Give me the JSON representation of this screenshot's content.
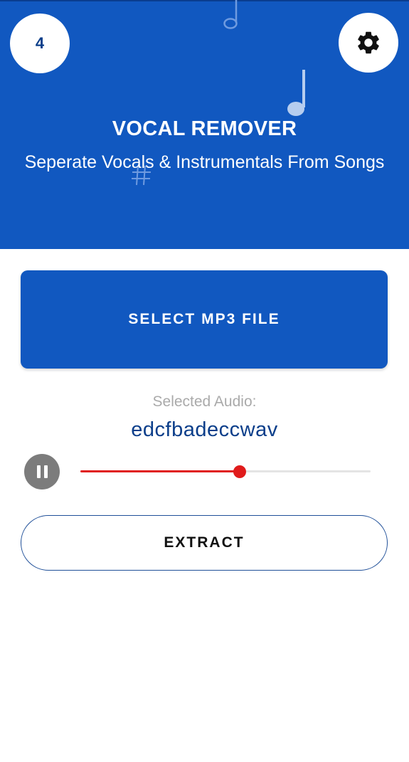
{
  "header": {
    "badge_count": "4",
    "title": "VOCAL REMOVER",
    "subtitle": "Seperate Vocals & Instrumentals From Songs",
    "settings_icon": "gear-icon",
    "decorations": [
      "music-note-icon",
      "music-note-icon",
      "sharp-icon"
    ]
  },
  "main": {
    "select_button_label": "SELECT MP3 FILE",
    "selected_label": "Selected Audio:",
    "selected_name": "edcfbadeccwav",
    "extract_button_label": "EXTRACT"
  },
  "player": {
    "state_icon": "pause-icon",
    "progress_fraction": 0.55
  },
  "colors": {
    "primary": "#1158c0",
    "accent": "#e01b1b",
    "text_dark_blue": "#0b3e8a",
    "muted": "#aaaaaa"
  }
}
